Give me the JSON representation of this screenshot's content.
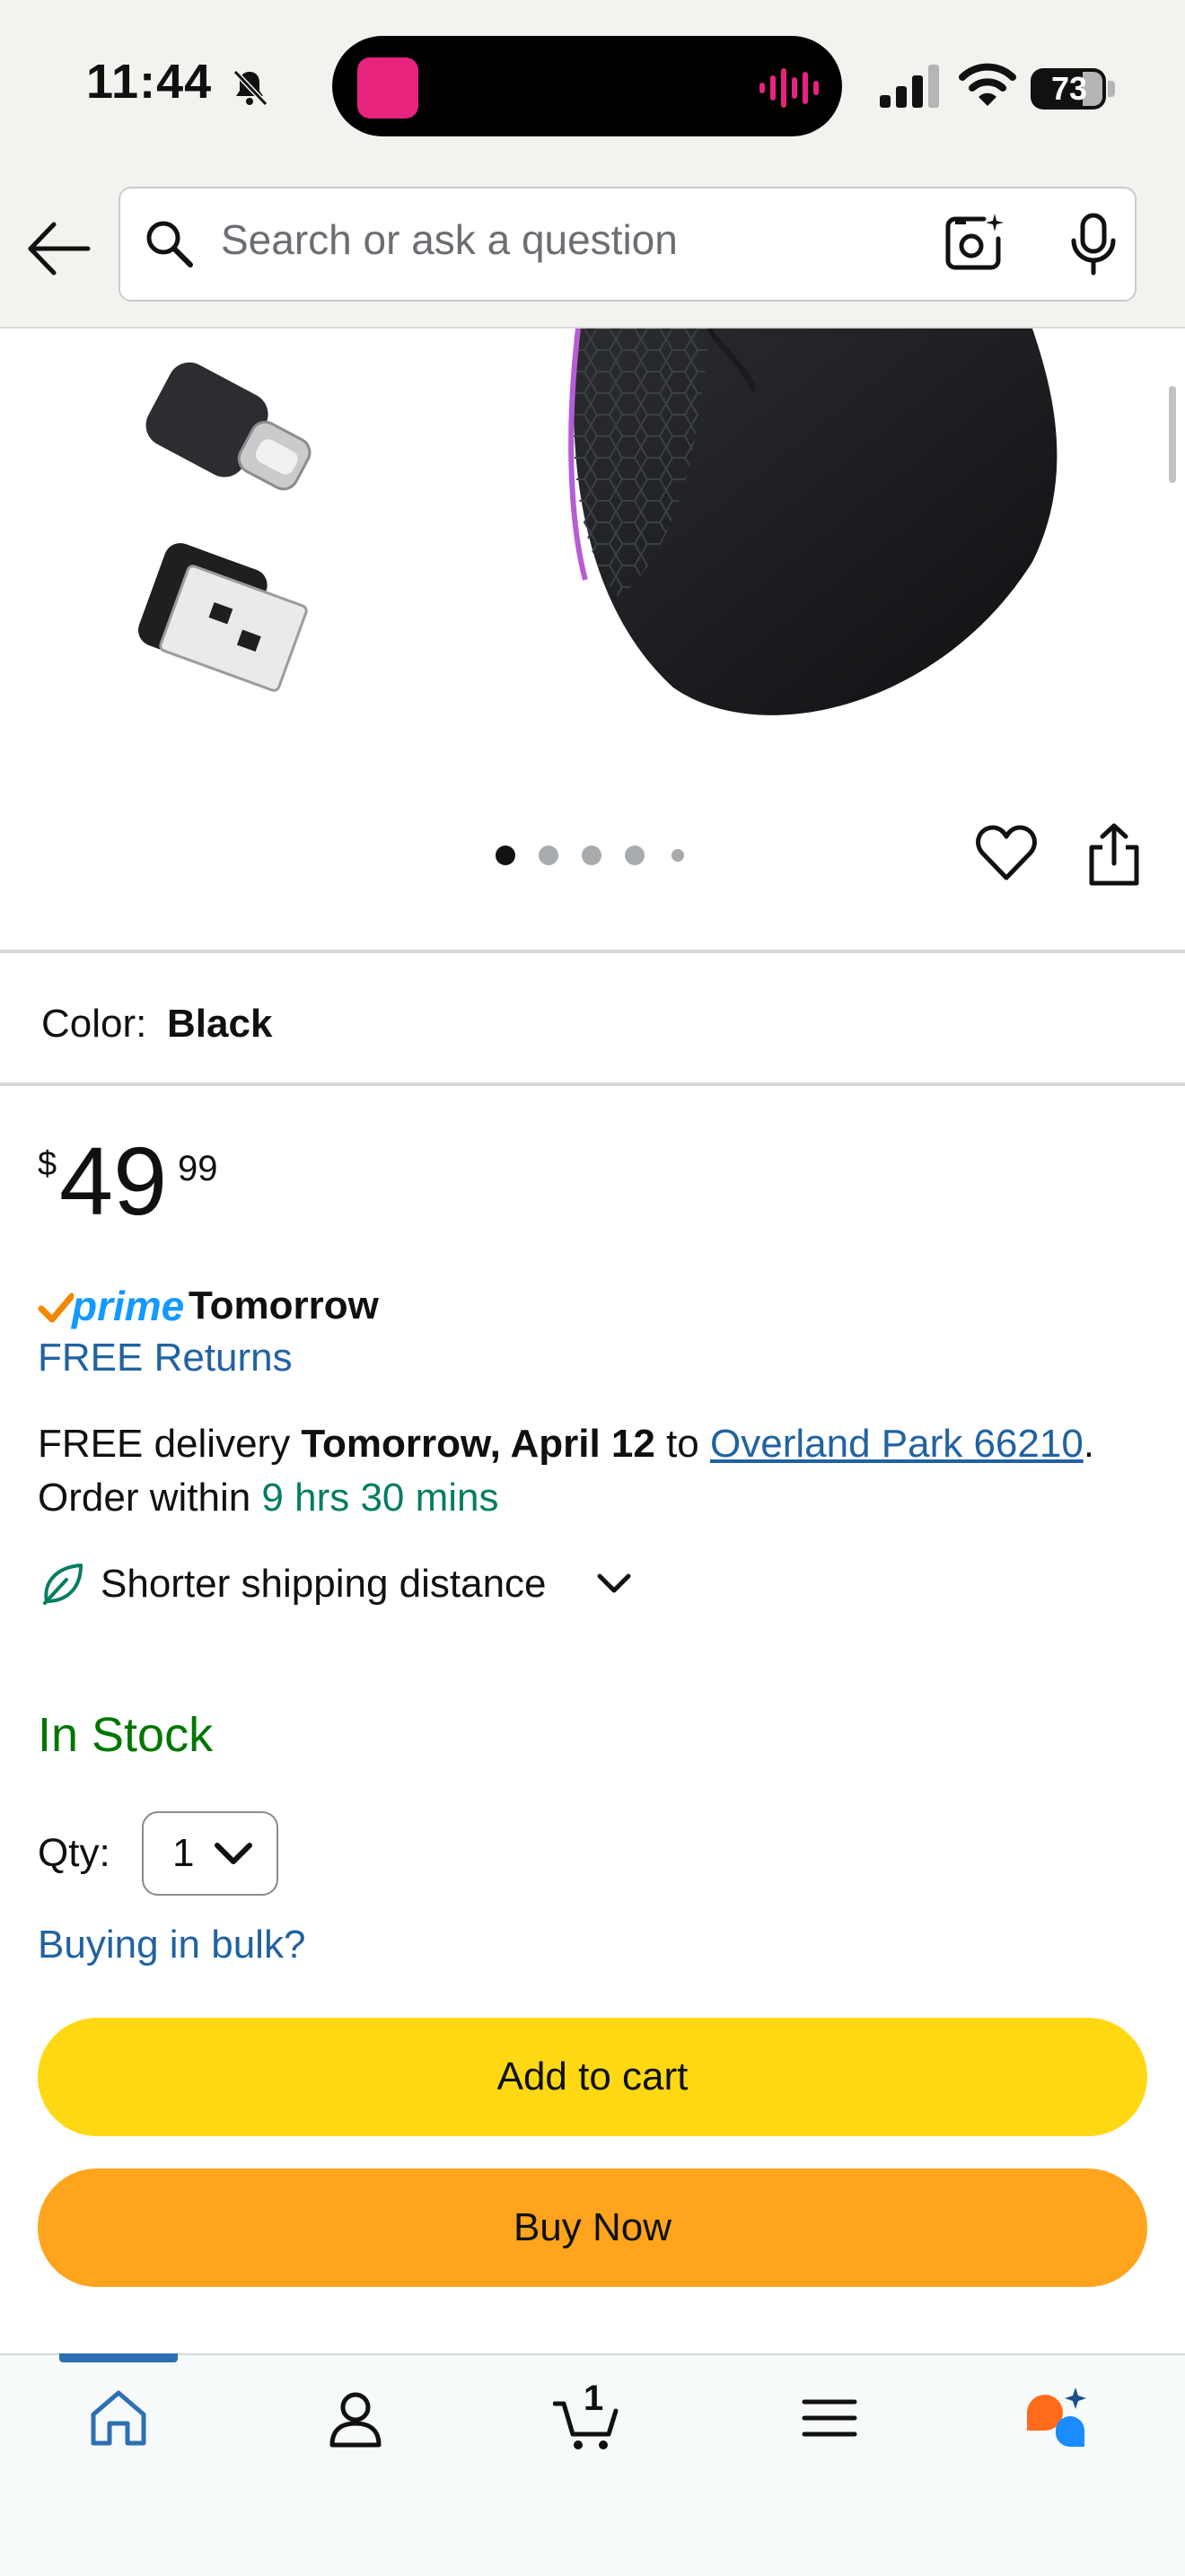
{
  "status_bar": {
    "time": "11:44",
    "battery": "73",
    "icons": [
      "bell-slash-icon",
      "signal-icon",
      "wifi-icon",
      "battery-icon"
    ]
  },
  "header": {
    "back_icon": "arrow-left-icon",
    "search_placeholder": "Search or ask a question",
    "icons": [
      "search-icon",
      "camera-lens-icon",
      "microphone-icon"
    ]
  },
  "gallery": {
    "image_count": 5,
    "active_index": 0,
    "icons": [
      "heart-icon",
      "share-icon"
    ]
  },
  "product": {
    "color_label": "Color:",
    "color_value": "Black",
    "price_symbol": "$",
    "price_whole": "49",
    "price_fraction": "99"
  },
  "delivery": {
    "prime_word": "prime",
    "prime_when": "Tomorrow",
    "free_returns": "FREE Returns",
    "line1_prefix": "FREE delivery ",
    "line1_date": "Tomorrow, April 12",
    "line1_to": " to ",
    "line1_location": "Overland Park 66210",
    "line1_suffix": ".",
    "line2_prefix": "Order within ",
    "line2_time": "9 hrs 30 mins",
    "shipping_note": "Shorter shipping distance"
  },
  "stock": {
    "status": "In Stock",
    "qty_label": "Qty:",
    "qty_value": "1",
    "bulk_link": "Buying in bulk?"
  },
  "actions": {
    "add_to_cart": "Add to cart",
    "buy_now": "Buy Now"
  },
  "bottom_nav": {
    "cart_count": "1",
    "items": [
      "home-icon",
      "account-icon",
      "cart-icon",
      "menu-icon",
      "rufus-assistant-icon"
    ]
  },
  "colors": {
    "add_to_cart_bg": "#ffd814",
    "buy_now_bg": "#ffa41c",
    "link": "#2162a1",
    "in_stock": "#007600",
    "prime_blue": "#1399ff",
    "countdown_green": "#067d62"
  }
}
